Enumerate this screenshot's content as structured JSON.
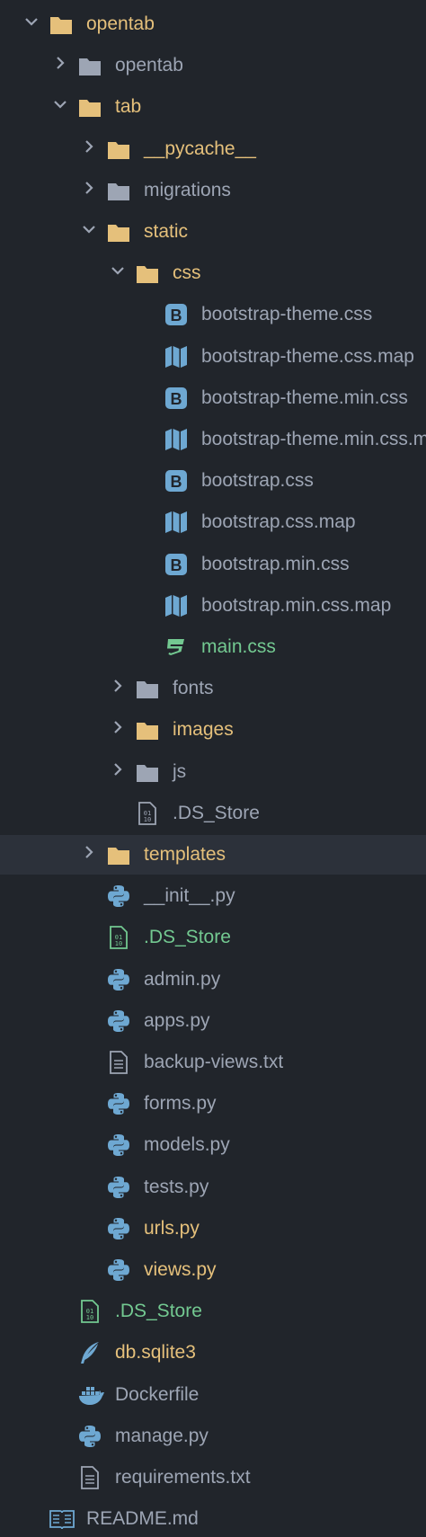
{
  "colors": {
    "background": "#21252b",
    "selected_row": "#2c313a",
    "text_default": "#9da5b4",
    "text_modified": "#e5c07b",
    "text_untracked": "#73c991",
    "folder_yellow": "#e5c07b",
    "folder_gray": "#9da5b4",
    "bootstrap_icon": "#6ea8d2",
    "python_icon": "#6ea8d2"
  },
  "tree": [
    {
      "name": "opentab",
      "icon": "folder-yellow",
      "chevron": "down",
      "status": "modified",
      "depth": 0
    },
    {
      "name": "opentab",
      "icon": "folder-gray",
      "chevron": "right",
      "status": "normal",
      "depth": 1
    },
    {
      "name": "tab",
      "icon": "folder-yellow",
      "chevron": "down",
      "status": "modified",
      "depth": 1
    },
    {
      "name": "__pycache__",
      "icon": "folder-yellow",
      "chevron": "right",
      "status": "modified",
      "depth": 2
    },
    {
      "name": "migrations",
      "icon": "folder-gray",
      "chevron": "right",
      "status": "normal",
      "depth": 2
    },
    {
      "name": "static",
      "icon": "folder-yellow",
      "chevron": "down",
      "status": "modified",
      "depth": 2
    },
    {
      "name": "css",
      "icon": "folder-yellow",
      "chevron": "down",
      "status": "modified",
      "depth": 3
    },
    {
      "name": "bootstrap-theme.css",
      "icon": "bootstrap",
      "chevron": "none",
      "status": "normal",
      "depth": 4
    },
    {
      "name": "bootstrap-theme.css.map",
      "icon": "map",
      "chevron": "none",
      "status": "normal",
      "depth": 4
    },
    {
      "name": "bootstrap-theme.min.css",
      "icon": "bootstrap",
      "chevron": "none",
      "status": "normal",
      "depth": 4
    },
    {
      "name": "bootstrap-theme.min.css.map",
      "icon": "map",
      "chevron": "none",
      "status": "normal",
      "depth": 4
    },
    {
      "name": "bootstrap.css",
      "icon": "bootstrap",
      "chevron": "none",
      "status": "normal",
      "depth": 4
    },
    {
      "name": "bootstrap.css.map",
      "icon": "map",
      "chevron": "none",
      "status": "normal",
      "depth": 4
    },
    {
      "name": "bootstrap.min.css",
      "icon": "bootstrap",
      "chevron": "none",
      "status": "normal",
      "depth": 4
    },
    {
      "name": "bootstrap.min.css.map",
      "icon": "map",
      "chevron": "none",
      "status": "normal",
      "depth": 4
    },
    {
      "name": "main.css",
      "icon": "css3",
      "chevron": "none",
      "status": "untracked",
      "depth": 4
    },
    {
      "name": "fonts",
      "icon": "folder-gray",
      "chevron": "right",
      "status": "normal",
      "depth": 3
    },
    {
      "name": "images",
      "icon": "folder-yellow",
      "chevron": "right",
      "status": "modified",
      "depth": 3
    },
    {
      "name": "js",
      "icon": "folder-gray",
      "chevron": "right",
      "status": "normal",
      "depth": 3
    },
    {
      "name": ".DS_Store",
      "icon": "binary",
      "chevron": "none",
      "status": "normal",
      "depth": 3
    },
    {
      "name": "templates",
      "icon": "folder-yellow",
      "chevron": "right",
      "status": "modified",
      "depth": 2,
      "selected": true
    },
    {
      "name": "__init__.py",
      "icon": "python",
      "chevron": "none",
      "status": "normal",
      "depth": 2
    },
    {
      "name": ".DS_Store",
      "icon": "binary",
      "chevron": "none",
      "status": "untracked",
      "depth": 2
    },
    {
      "name": "admin.py",
      "icon": "python",
      "chevron": "none",
      "status": "normal",
      "depth": 2
    },
    {
      "name": "apps.py",
      "icon": "python",
      "chevron": "none",
      "status": "normal",
      "depth": 2
    },
    {
      "name": "backup-views.txt",
      "icon": "text",
      "chevron": "none",
      "status": "normal",
      "depth": 2
    },
    {
      "name": "forms.py",
      "icon": "python",
      "chevron": "none",
      "status": "normal",
      "depth": 2
    },
    {
      "name": "models.py",
      "icon": "python",
      "chevron": "none",
      "status": "normal",
      "depth": 2
    },
    {
      "name": "tests.py",
      "icon": "python",
      "chevron": "none",
      "status": "normal",
      "depth": 2
    },
    {
      "name": "urls.py",
      "icon": "python",
      "chevron": "none",
      "status": "modified",
      "depth": 2
    },
    {
      "name": "views.py",
      "icon": "python",
      "chevron": "none",
      "status": "modified",
      "depth": 2
    },
    {
      "name": ".DS_Store",
      "icon": "binary",
      "chevron": "none",
      "status": "untracked",
      "depth": 1
    },
    {
      "name": "db.sqlite3",
      "icon": "sqlite",
      "chevron": "none",
      "status": "modified",
      "depth": 1
    },
    {
      "name": "Dockerfile",
      "icon": "docker",
      "chevron": "none",
      "status": "normal",
      "depth": 1
    },
    {
      "name": "manage.py",
      "icon": "python",
      "chevron": "none",
      "status": "normal",
      "depth": 1
    },
    {
      "name": "requirements.txt",
      "icon": "text",
      "chevron": "none",
      "status": "normal",
      "depth": 1
    },
    {
      "name": "README.md",
      "icon": "readme",
      "chevron": "none",
      "status": "normal",
      "depth": 0
    }
  ]
}
